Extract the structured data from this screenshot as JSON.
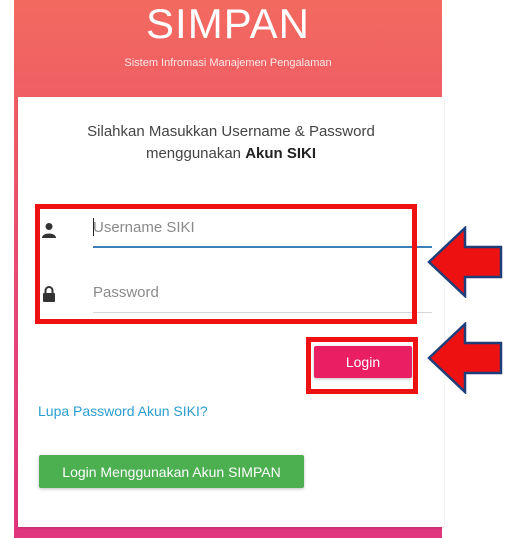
{
  "header": {
    "title": "SIMPAN",
    "subtitle": "Sistem Infromasi Manajemen Pengalaman"
  },
  "login_card": {
    "instruction_line1": "Silahkan Masukkan Username & Password",
    "instruction_prefix": "menggunakan",
    "instruction_bold": "Akun SIKI",
    "username": {
      "placeholder": "Username SIKI",
      "value": "",
      "icon": "user-icon"
    },
    "password": {
      "placeholder": "Password",
      "value": "",
      "icon": "lock-icon"
    },
    "login_label": "Login",
    "forgot_label": "Lupa Password Akun SIKI?",
    "alt_login_label": "Login Menggunakan Akun SIMPAN"
  },
  "colors": {
    "header_gradient_top": "#f26a5f",
    "header_gradient_bottom": "#e0357f",
    "login_button": "#e91e63",
    "alt_login_button": "#4caf50",
    "link": "#2a9ecf",
    "focus_underline": "#3f7fb9",
    "annotation_red": "#ee1111",
    "arrow_outline": "#1f3f7a"
  }
}
